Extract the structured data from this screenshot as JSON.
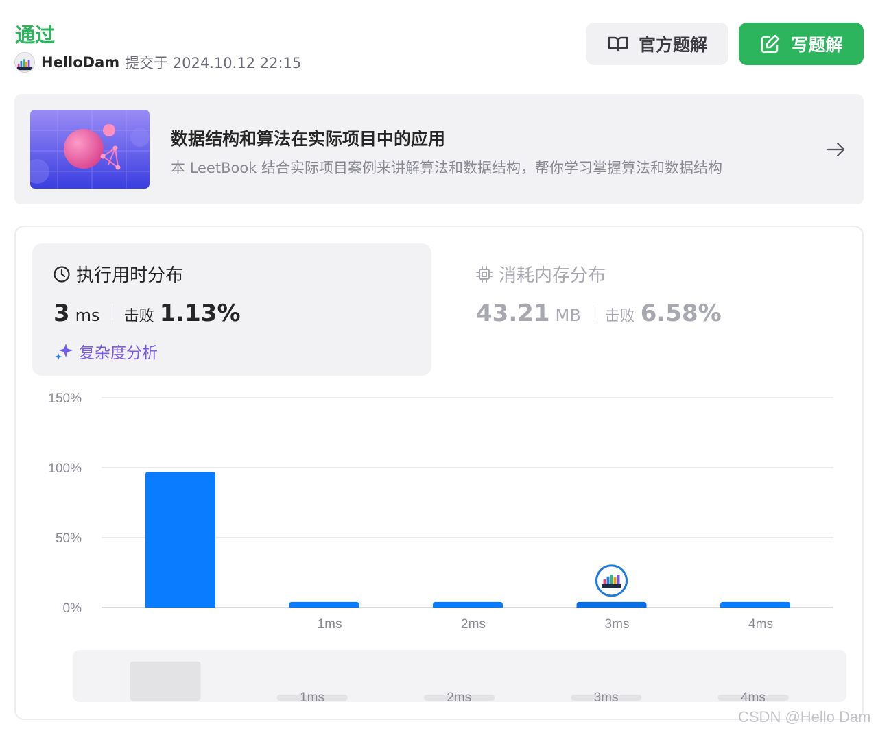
{
  "header": {
    "status": "通过",
    "username": "HelloDam",
    "submitted_text": "提交于 2024.10.12 22:15",
    "avatar_icon": "user-avatar-icon"
  },
  "actions": {
    "official_solution": "官方题解",
    "official_icon": "open-book-icon",
    "write_solution": "写题解",
    "write_icon": "edit-icon"
  },
  "leetbook": {
    "title": "数据结构和算法在实际项目中的应用",
    "description": "本 LeetBook 结合实际项目案例来讲解算法和数据结构，帮你学习掌握算法和数据结构",
    "arrow_icon": "arrow-right-icon"
  },
  "runtime": {
    "heading": "执行用时分布",
    "icon": "clock-icon",
    "value": "3",
    "unit": "ms",
    "beat_label": "击败",
    "beat_pct": "1.13%",
    "analysis_link": "复杂度分析",
    "analysis_icon": "sparkle-icon"
  },
  "memory": {
    "heading": "消耗内存分布",
    "icon": "chip-icon",
    "value": "43.21",
    "unit": "MB",
    "beat_label": "击败",
    "beat_pct": "6.58%"
  },
  "colors": {
    "accent_green": "#2db55d",
    "bar_blue": "#0a7cff",
    "analysis_purple": "#7c5ce5"
  },
  "chart_data": {
    "type": "bar",
    "categories": [
      "",
      "1ms",
      "2ms",
      "3ms",
      "4ms"
    ],
    "values": [
      97,
      4,
      4,
      4,
      4
    ],
    "ylim": [
      0,
      150
    ],
    "yticks": [
      "0%",
      "50%",
      "100%",
      "150%"
    ],
    "ytick_values": [
      0,
      50,
      100,
      150
    ],
    "grid": true,
    "highlight_category": "3ms",
    "navigator_ticks": [
      "1ms",
      "2ms",
      "3ms",
      "4ms"
    ]
  },
  "watermark": "CSDN @Hello Dam"
}
